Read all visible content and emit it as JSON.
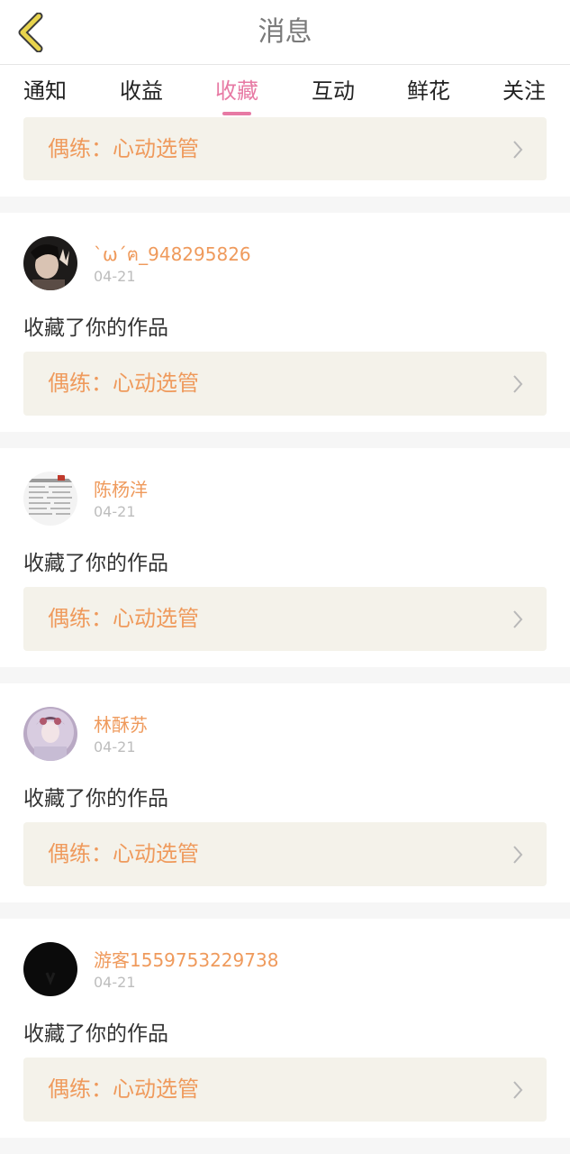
{
  "header": {
    "title": "消息"
  },
  "tabs": [
    {
      "label": "通知"
    },
    {
      "label": "收益"
    },
    {
      "label": "收藏"
    },
    {
      "label": "互动"
    },
    {
      "label": "鲜花"
    },
    {
      "label": "关注"
    }
  ],
  "active_tab": "收藏",
  "top_card": {
    "work": "偶练：心动选管"
  },
  "messages": [
    {
      "username": "`ω´ฅ_948295826",
      "date": "04-21",
      "action": "收藏了你的作品",
      "work": "偶练：心动选管"
    },
    {
      "username": "陈杨洋",
      "date": "04-21",
      "action": "收藏了你的作品",
      "work": "偶练：心动选管"
    },
    {
      "username": "林酥苏",
      "date": "04-21",
      "action": "收藏了你的作品",
      "work": "偶练：心动选管"
    },
    {
      "username": "游客1559753229738",
      "date": "04-21",
      "action": "收藏了你的作品",
      "work": "偶练：心动选管"
    }
  ],
  "colors": {
    "accent": "#e77aa4",
    "work_text": "#ef9a5c",
    "card_bg": "#f4f2ea",
    "back_icon": "#e8d44d"
  }
}
